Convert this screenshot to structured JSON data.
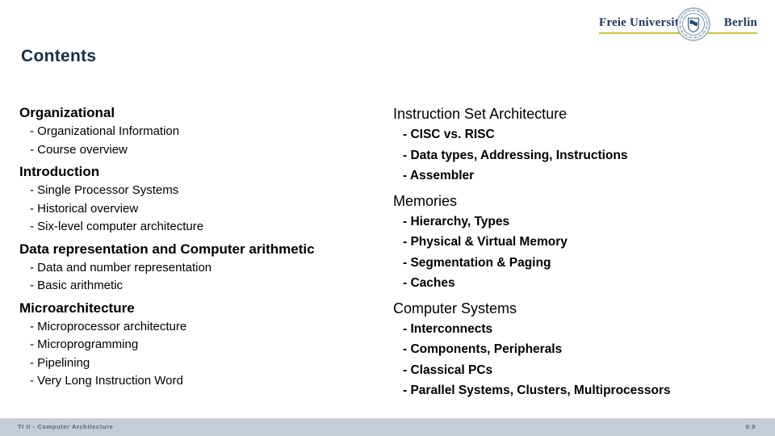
{
  "header": {
    "logo": {
      "name": "freie-universitaet-berlin-logo",
      "word_left": "Freie Universität",
      "word_right": "Berlin",
      "seal_icon": "university-seal-icon",
      "rule_color": "#c8c832",
      "text_color": "#1f3864"
    }
  },
  "title": {
    "text": "Contents",
    "color": "#133047"
  },
  "columns": {
    "left": [
      {
        "heading": "Organizational",
        "items": [
          "- Organizational Information",
          "- Course overview"
        ]
      },
      {
        "heading": "Introduction",
        "items": [
          "- Single Processor Systems",
          "- Historical overview",
          "- Six-level computer architecture"
        ]
      },
      {
        "heading": "Data representation and Computer arithmetic",
        "items": [
          "- Data and number representation",
          "- Basic arithmetic"
        ]
      },
      {
        "heading": "Microarchitecture",
        "items": [
          "- Microprocessor architecture",
          "- Microprogramming",
          "- Pipelining",
          "- Very Long Instruction Word"
        ]
      }
    ],
    "right": [
      {
        "heading": "Instruction Set Architecture",
        "items": [
          "- CISC vs. RISC",
          "- Data types, Addressing, Instructions",
          "- Assembler"
        ]
      },
      {
        "heading": "Memories",
        "items": [
          "- Hierarchy, Types",
          "- Physical & Virtual Memory",
          "- Segmentation & Paging",
          "- Caches"
        ]
      },
      {
        "heading": "Computer Systems",
        "items": [
          "- Interconnects",
          "- Components, Peripherals",
          "- Classical PCs",
          "- Parallel Systems, Clusters, Multiprocessors"
        ]
      }
    ]
  },
  "footer": {
    "text": "TI II - Computer Architecture",
    "page_number": "0.9",
    "background_color": "#c6ccd6",
    "text_color": "#5d6473"
  }
}
